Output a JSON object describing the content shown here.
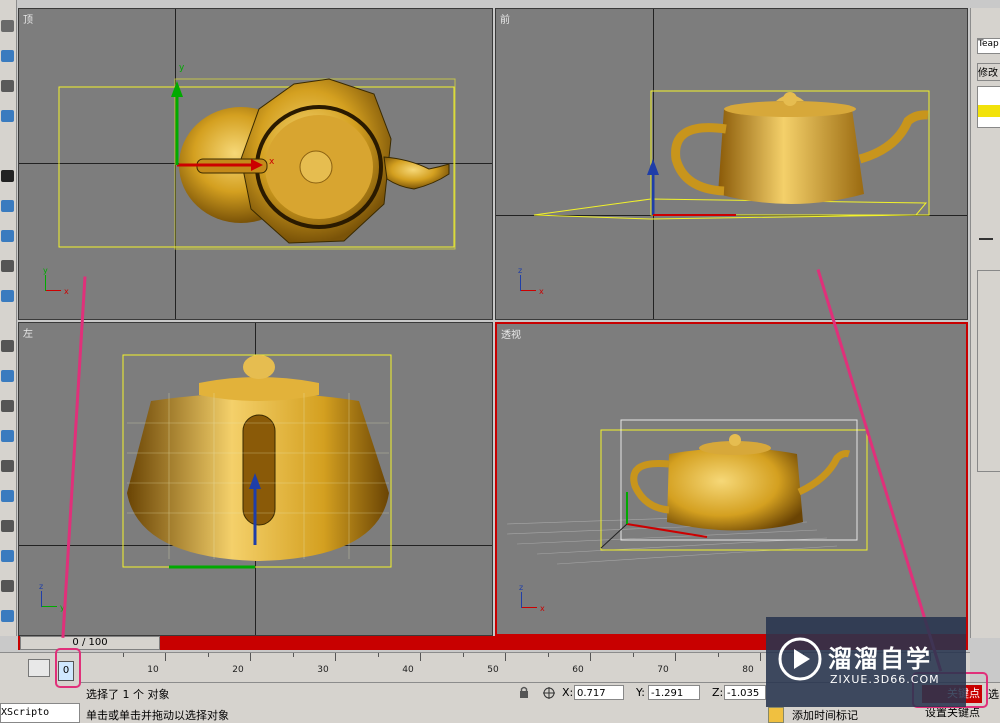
{
  "viewports": {
    "top": {
      "label": "顶"
    },
    "front": {
      "label": "前"
    },
    "left": {
      "label": "左"
    },
    "perspective": {
      "label": "透视"
    }
  },
  "axes": {
    "x": "x",
    "y": "y",
    "z": "z"
  },
  "right_panel": {
    "object_name": "Teap",
    "modify_label": "修改"
  },
  "timeline": {
    "slider_text": "0 / 100",
    "frame_box": "0",
    "ticks": [
      "10",
      "20",
      "30",
      "40",
      "50",
      "60",
      "70",
      "80"
    ]
  },
  "status": {
    "selection_text": "选择了 1 个 对象",
    "prompt_text": "单击或单击并拖动以选择对象",
    "x_label": "X:",
    "x_value": "0.717",
    "y_label": "Y:",
    "y_value": "-1.291",
    "z_label": "Z:",
    "z_value": "-1.035",
    "add_time_tag": "添加时间标记",
    "auto_key": "关键点",
    "set_key": "设置关键点",
    "maxscript": "XScripto",
    "selected_short": "选"
  },
  "watermark": {
    "brand": "溜溜自学",
    "url": "ZIXUE.3D66.COM"
  },
  "colors": {
    "active_border": "#c80000",
    "highlight": "#e0307a",
    "viewport_bg": "#7d7d7d",
    "teapot": "#d4a020"
  }
}
